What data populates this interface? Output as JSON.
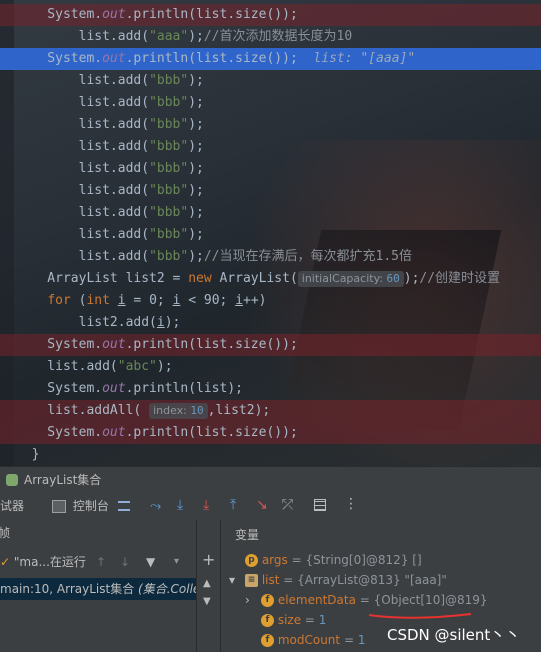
{
  "code_lines": [
    {
      "cls": "red",
      "segs": [
        {
          "t": "    System.",
          "c": ""
        },
        {
          "t": "out",
          "c": "fld"
        },
        {
          "t": ".println(list.size());",
          "c": ""
        }
      ]
    },
    {
      "cls": "",
      "segs": [
        {
          "t": "        list.add(",
          "c": ""
        },
        {
          "t": "\"aaa\"",
          "c": "str"
        },
        {
          "t": ");",
          "c": ""
        },
        {
          "t": "//首次添加数据长度为10",
          "c": "cmt"
        }
      ]
    },
    {
      "cls": "sel",
      "segs": [
        {
          "t": "    System.",
          "c": ""
        },
        {
          "t": "out",
          "c": "fld"
        },
        {
          "t": ".println(list.size());  ",
          "c": ""
        },
        {
          "t": "list: \"[aaa]\"",
          "c": "inlinedbg"
        }
      ]
    },
    {
      "cls": "",
      "segs": [
        {
          "t": "        list.add(",
          "c": ""
        },
        {
          "t": "\"bbb\"",
          "c": "str"
        },
        {
          "t": ");",
          "c": ""
        }
      ]
    },
    {
      "cls": "",
      "segs": [
        {
          "t": "        list.add(",
          "c": ""
        },
        {
          "t": "\"bbb\"",
          "c": "str"
        },
        {
          "t": ");",
          "c": ""
        }
      ]
    },
    {
      "cls": "",
      "segs": [
        {
          "t": "        list.add(",
          "c": ""
        },
        {
          "t": "\"bbb\"",
          "c": "str"
        },
        {
          "t": ");",
          "c": ""
        }
      ]
    },
    {
      "cls": "",
      "segs": [
        {
          "t": "        list.add(",
          "c": ""
        },
        {
          "t": "\"bbb\"",
          "c": "str"
        },
        {
          "t": ");",
          "c": ""
        }
      ]
    },
    {
      "cls": "",
      "segs": [
        {
          "t": "        list.add(",
          "c": ""
        },
        {
          "t": "\"bbb\"",
          "c": "str"
        },
        {
          "t": ");",
          "c": ""
        }
      ]
    },
    {
      "cls": "",
      "segs": [
        {
          "t": "        list.add(",
          "c": ""
        },
        {
          "t": "\"bbb\"",
          "c": "str"
        },
        {
          "t": ");",
          "c": ""
        }
      ]
    },
    {
      "cls": "",
      "segs": [
        {
          "t": "        list.add(",
          "c": ""
        },
        {
          "t": "\"bbb\"",
          "c": "str"
        },
        {
          "t": ");",
          "c": ""
        }
      ]
    },
    {
      "cls": "",
      "segs": [
        {
          "t": "        list.add(",
          "c": ""
        },
        {
          "t": "\"bbb\"",
          "c": "str"
        },
        {
          "t": ");",
          "c": ""
        }
      ]
    },
    {
      "cls": "",
      "segs": [
        {
          "t": "        list.add(",
          "c": ""
        },
        {
          "t": "\"bbb\"",
          "c": "str"
        },
        {
          "t": ");",
          "c": ""
        },
        {
          "t": "//当现在存满后，每次都扩充1.5倍",
          "c": "cmt"
        }
      ]
    },
    {
      "cls": "",
      "segs": [
        {
          "t": "    ArrayList list2 = ",
          "c": ""
        },
        {
          "t": "new",
          "c": "kw"
        },
        {
          "t": " ArrayList(",
          "c": ""
        },
        {
          "hint": "initialCapacity:",
          "hv": "60"
        },
        {
          "t": ");",
          "c": ""
        },
        {
          "t": "//创建时设置",
          "c": "cmt"
        }
      ]
    },
    {
      "cls": "",
      "segs": [
        {
          "t": "    ",
          "c": ""
        },
        {
          "t": "for",
          "c": "kw"
        },
        {
          "t": " (",
          "c": ""
        },
        {
          "t": "int",
          "c": "kw"
        },
        {
          "t": " ",
          "c": ""
        },
        {
          "t": "i",
          "c": "ul"
        },
        {
          "t": " = 0; ",
          "c": ""
        },
        {
          "t": "i",
          "c": "ul"
        },
        {
          "t": " < 90; ",
          "c": ""
        },
        {
          "t": "i",
          "c": "ul"
        },
        {
          "t": "++)",
          "c": ""
        }
      ]
    },
    {
      "cls": "",
      "segs": [
        {
          "t": "        list2.add(",
          "c": ""
        },
        {
          "t": "i",
          "c": "ul"
        },
        {
          "t": ");",
          "c": ""
        }
      ]
    },
    {
      "cls": "red",
      "segs": [
        {
          "t": "    System.",
          "c": ""
        },
        {
          "t": "out",
          "c": "fld"
        },
        {
          "t": ".println(list.size());",
          "c": ""
        }
      ]
    },
    {
      "cls": "",
      "segs": [
        {
          "t": "    list.add(",
          "c": ""
        },
        {
          "t": "\"abc\"",
          "c": "str"
        },
        {
          "t": ");",
          "c": ""
        }
      ]
    },
    {
      "cls": "",
      "segs": [
        {
          "t": "    System.",
          "c": ""
        },
        {
          "t": "out",
          "c": "fld"
        },
        {
          "t": ".println(list);",
          "c": ""
        }
      ]
    },
    {
      "cls": "red",
      "segs": [
        {
          "t": "    list.addAll( ",
          "c": ""
        },
        {
          "hint": "index:",
          "hv": "10"
        },
        {
          "t": ",list2);",
          "c": ""
        }
      ]
    },
    {
      "cls": "red",
      "segs": [
        {
          "t": "    System.",
          "c": ""
        },
        {
          "t": "out",
          "c": "fld"
        },
        {
          "t": ".println(list.size());",
          "c": ""
        }
      ]
    },
    {
      "cls": "",
      "segs": [
        {
          "t": "  }",
          "c": ""
        }
      ]
    }
  ],
  "tool_window": {
    "title": "ArrayList集合"
  },
  "debug_toolbar": {
    "debugger_tab": "调试器",
    "console_tab": "控制台"
  },
  "frames": {
    "header": "帧",
    "thread": "\"ma...在运行",
    "frame_row": "main:10, ArrayList集合 ",
    "frame_class": "(集合.Collec"
  },
  "variables": {
    "header": "变量",
    "rows": [
      {
        "indent": 0,
        "arrow": "",
        "badge": "p",
        "name": "args",
        "meta": " = {String[0]@812} ",
        "value": "[]",
        "vc": "vmeta"
      },
      {
        "indent": 0,
        "arrow": "▾",
        "badge": "≡",
        "name": "list",
        "meta": " = {ArrayList@813} ",
        "value": "\"[aaa]\"",
        "vc": "vmeta"
      },
      {
        "indent": 1,
        "arrow": "›",
        "badge": "f",
        "name": "elementData",
        "meta": " = ",
        "value": "{Object[10]@819}",
        "vc": "vmeta"
      },
      {
        "indent": 1,
        "arrow": "",
        "badge": "f",
        "name": "size",
        "meta": " = ",
        "value": "1",
        "vc": "vnum"
      },
      {
        "indent": 1,
        "arrow": "",
        "badge": "f",
        "name": "modCount",
        "meta": " = ",
        "value": "1",
        "vc": "vnum"
      }
    ]
  },
  "watermark": "CSDN @silent丶丶"
}
